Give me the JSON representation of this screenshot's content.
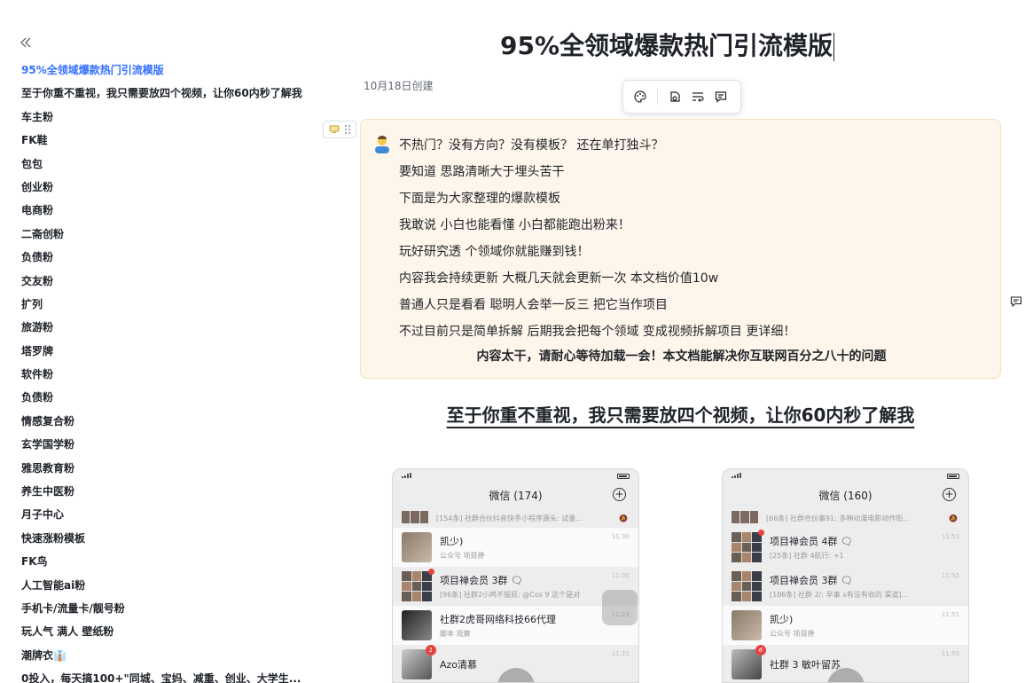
{
  "sidebar": {
    "collapse_icon": "double-chevron-left-icon",
    "items": [
      {
        "label": "95%全领域爆款热门引流模版",
        "active": true
      },
      {
        "label": "至于你重不重视，我只需要放四个视频，让你60内秒了解我"
      },
      {
        "label": "车主粉"
      },
      {
        "label": "FK鞋"
      },
      {
        "label": "包包"
      },
      {
        "label": "创业粉"
      },
      {
        "label": "电商粉"
      },
      {
        "label": "二斋创粉"
      },
      {
        "label": "负债粉"
      },
      {
        "label": "交友粉"
      },
      {
        "label": "扩列"
      },
      {
        "label": "旅游粉"
      },
      {
        "label": "塔罗牌"
      },
      {
        "label": "软件粉"
      },
      {
        "label": "负债粉"
      },
      {
        "label": "情感复合粉"
      },
      {
        "label": "玄学国学粉"
      },
      {
        "label": "雅思教育粉"
      },
      {
        "label": "养生中医粉"
      },
      {
        "label": "月子中心"
      },
      {
        "label": "快速涨粉模板"
      },
      {
        "label": "FK鸟"
      },
      {
        "label": "人工智能ai粉"
      },
      {
        "label": "手机卡/流量卡/靓号粉"
      },
      {
        "label": "玩人气 满人 壁纸粉"
      },
      {
        "label": "潮牌衣👔"
      },
      {
        "label": "0投入，每天搞100+\"同城、宝妈、减重、创业、大学生..."
      }
    ]
  },
  "doc": {
    "title": "95%全领域爆款热门引流模版",
    "created": "10月18日创建"
  },
  "toolbar": {
    "icons": [
      "palette-icon",
      "link-edit-icon",
      "text-wrap-icon",
      "comment-icon"
    ]
  },
  "callout": {
    "emoji": "person-emoji-icon",
    "lines": [
      "不热门？没有方向？没有模板？  还在单打独斗？",
      "要知道 思路清晰大于埋头苦干",
      "下面是为大家整理的爆款模板",
      "我敢说 小白也能看懂 小白都能跑出粉来！",
      "玩好研究透    个领域你就能赚到钱！",
      "内容我会持续更新 大概几天就会更新一次 本文档价值10w",
      "普通人只是看看 聪明人会举一反三 把它当作项目",
      "不过目前只是简单拆解 后期我会把每个领域 变成视频拆解项目 更详细！"
    ],
    "bold": "内容太干，请耐心等待加载一会！本文档能解决你互联网百分之八十的问题"
  },
  "section_heading": "至于你重不重视，我只需要放四个视频，让你60内秒了解我",
  "phones": [
    {
      "title": "微信 (174)",
      "chats": [
        {
          "name": "",
          "sub": "[154条] 社群合伙抖音快手小程序源头: 试量..."
        },
        {
          "name": "凯少)",
          "sub": "公众号 项目搀",
          "time": "11:30"
        },
        {
          "name": "项目禅会员 3群 🗨",
          "sub": "[96条] 社群2小鸡不服屁: @Cos 9 这个是对",
          "time": "11:30"
        },
        {
          "name": "社群2虎哥网络科技66代理",
          "sub": "脚本 观察",
          "time": "11:23"
        },
        {
          "name": "Azo清慕",
          "sub": "",
          "time": "11:22",
          "badge": "1"
        }
      ]
    },
    {
      "title": "微信 (160)",
      "chats": [
        {
          "name": "",
          "sub": "[66条] 社群合伙事91: 多种动漫电影动作衔..."
        },
        {
          "name": "项目禅会员 4群 🗨",
          "sub": "[25条] 社群 4航行: +1",
          "time": "11:53"
        },
        {
          "name": "项目禅会员 3群 🗨",
          "sub": "[186条] 社群 2/: 早事 x有没有收的 渠道]...",
          "time": "11:52"
        },
        {
          "name": "凯少)",
          "sub": "公众号 项目搀",
          "time": "11:51"
        },
        {
          "name": "社群 3 敏叶留苏",
          "sub": "",
          "time": "11:50",
          "badge": "6"
        }
      ]
    }
  ]
}
